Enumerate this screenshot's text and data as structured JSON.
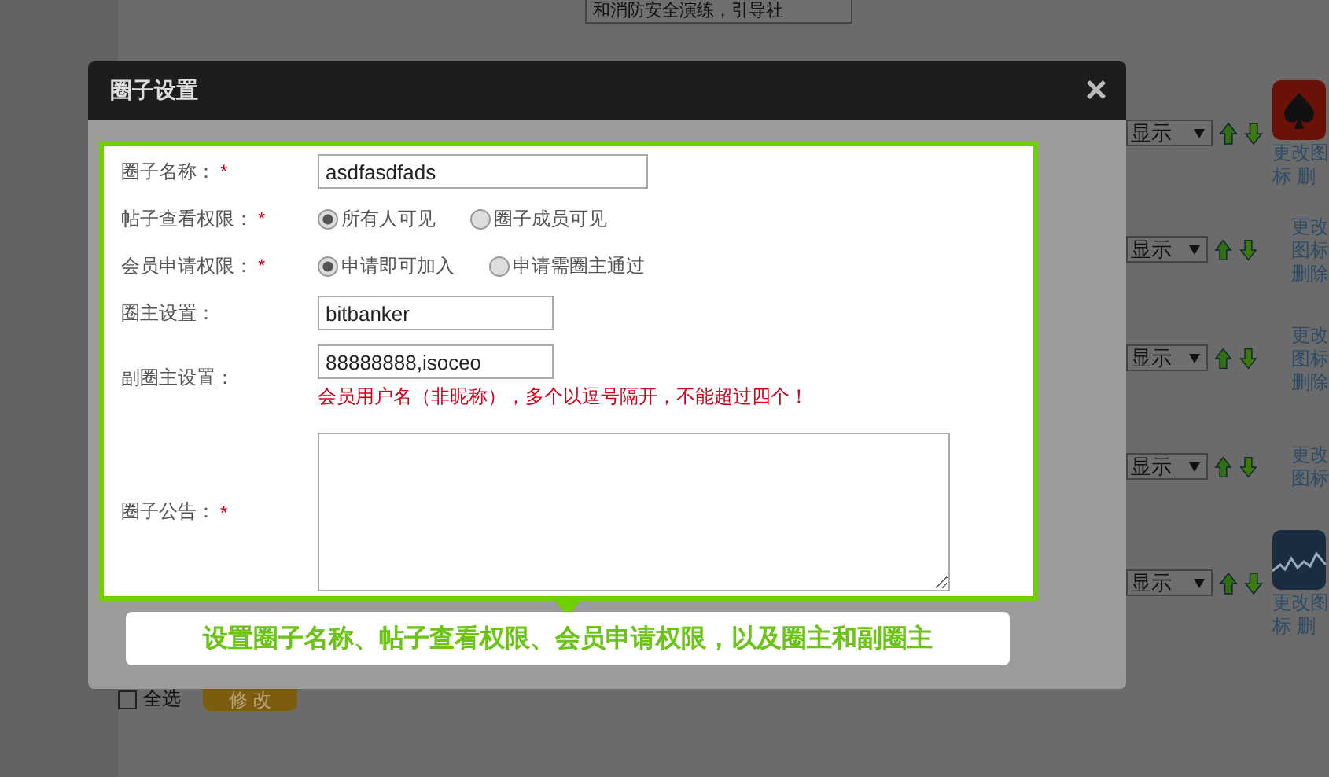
{
  "background": {
    "notice_text": "和消防安全演练，引导社",
    "rows": [
      {
        "visibility": "显示",
        "kind": "spade",
        "links": [
          "更改图",
          "标 删"
        ]
      },
      {
        "visibility": "显示",
        "kind": "plain",
        "links": [
          "更改",
          "图标",
          "删除"
        ]
      },
      {
        "visibility": "显示",
        "kind": "plain",
        "links": [
          "更改",
          "图标",
          "删除"
        ]
      },
      {
        "visibility": "显示",
        "kind": "plain",
        "links": [
          "更改",
          "图标"
        ]
      },
      {
        "visibility": "显示",
        "kind": "chart",
        "links": [
          "更改图",
          "标 删"
        ]
      }
    ],
    "select_all": {
      "label": "全选",
      "checked": false
    },
    "modify_button": "修 改"
  },
  "dialog": {
    "title": "圈子设置",
    "close": "×",
    "fields": [
      {
        "kind": "long_text",
        "label": "圈子名称：",
        "required_mark": "*",
        "value": "asdfasdfads"
      },
      {
        "kind": "radio",
        "label": "帖子查看权限：",
        "required_mark": "*",
        "options": [
          {
            "label": "所有人可见",
            "selected": true
          },
          {
            "label": "圈子成员可见",
            "selected": false
          }
        ]
      },
      {
        "kind": "radio",
        "label": "会员申请权限：",
        "required_mark": "*",
        "options": [
          {
            "label": "申请即可加入",
            "selected": true
          },
          {
            "label": "申请需圈主通过",
            "selected": false
          }
        ]
      },
      {
        "kind": "text",
        "label": "圈主设置：",
        "value": "bitbanker"
      },
      {
        "kind": "text",
        "label": "副圈主设置：",
        "value": "88888888,isoceo",
        "hint": "会员用户名（非昵称），多个以逗号隔开，不能超过四个！"
      },
      {
        "kind": "textarea",
        "label": "圈子公告：",
        "required_mark": "*"
      }
    ],
    "callout": "设置圈子名称、帖子查看权限、会员申请权限，以及圈主和副圈主"
  }
}
